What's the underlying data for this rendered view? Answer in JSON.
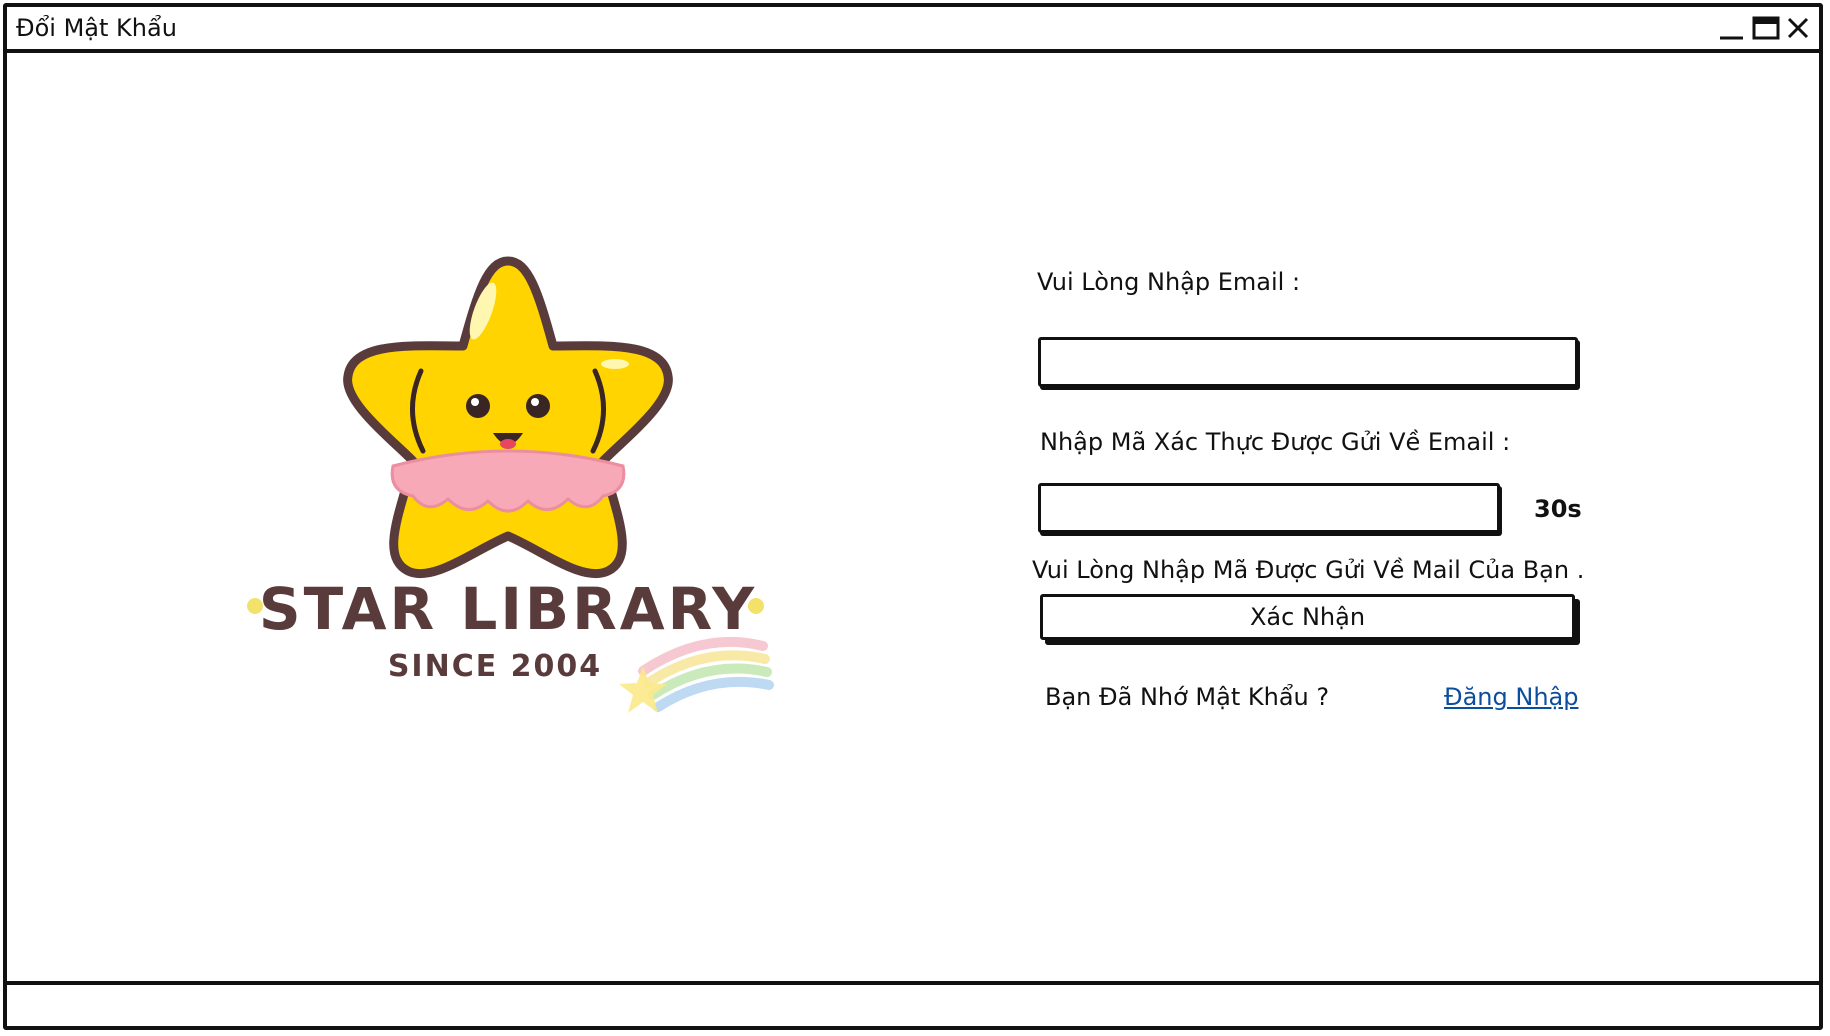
{
  "window": {
    "title": "Đổi Mật Khẩu",
    "controls": {
      "minimize": "minimize-icon",
      "maximize": "maximize-icon",
      "close": "close-icon"
    }
  },
  "logo": {
    "title": "STAR LIBRARY",
    "subtitle": "SINCE 2004"
  },
  "form": {
    "email_label": "Vui Lòng Nhập Email :",
    "email_value": "",
    "code_label": "Nhập Mã Xác Thực Được Gửi Về Email :",
    "code_value": "",
    "countdown": "30s",
    "hint": "Vui Lòng Nhập Mã Được Gửi Về Mail Của Bạn .",
    "confirm_label": "Xác Nhận",
    "remember_text": "Bạn Đã Nhớ Mật Khẩu ?",
    "login_link": "Đăng Nhập"
  },
  "colors": {
    "link": "#0b4e9e",
    "star": "#ffd400",
    "outline": "#5a3b3b",
    "skirt": "#f7a9b8"
  }
}
